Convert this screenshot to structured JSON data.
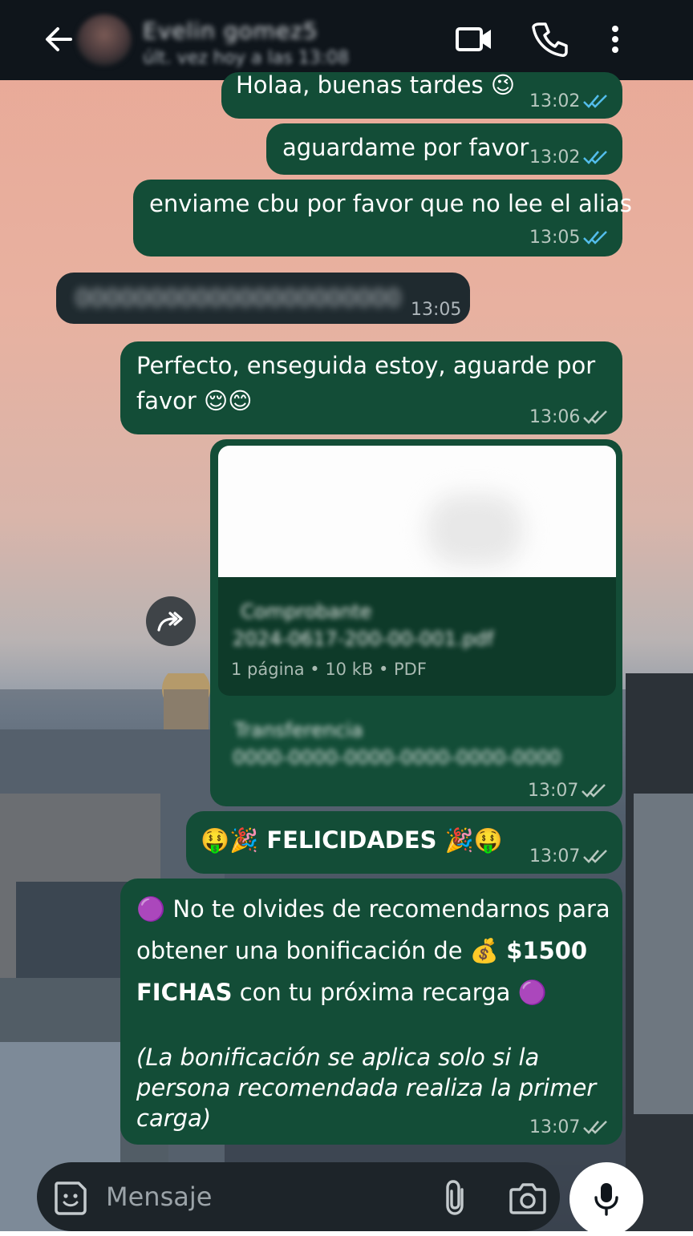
{
  "header": {
    "contact_name": "Evelin gomez5",
    "status": "últ. vez hoy a las 13:08"
  },
  "messages": [
    {
      "text": "Holaa, buenas tardes 😉",
      "time": "13:02"
    },
    {
      "text": "aguardame por favor",
      "time": "13:02"
    },
    {
      "text": "enviame cbu por favor que no lee el alias",
      "time": "13:05"
    },
    {
      "text": "0000000000000000000000",
      "time": "13:05"
    },
    {
      "text_line1": "Perfecto, enseguida estoy, aguarde por",
      "text_line2": "favor 😌😊",
      "time": "13:06"
    },
    {
      "doc_name": "Comprobante",
      "doc_file": "2024-0617-200-00-001.pdf",
      "doc_meta": "1 página • 10 kB • PDF",
      "caption_line1": "Transferencia",
      "caption_line2": "0000-0000-0000-0000-0000-0000",
      "time": "13:07"
    },
    {
      "text": "🤑🎉 FELICIDADES 🎉🤑",
      "time": "13:07"
    },
    {
      "line1": "🟣 No te olvides de recomendarnos para",
      "line2a": "obtener una bonificación de 💰",
      "line2b": "$1500",
      "line3a": "FICHAS",
      "line3b": " con tu próxima recarga 🟣",
      "italic1": "(La bonificación se aplica solo si la",
      "italic2": "persona recomendada realiza la primer",
      "italic3": "carga)",
      "time": "13:07"
    }
  ],
  "composer": {
    "placeholder": "Mensaje"
  },
  "icons": [
    "back-arrow-icon",
    "video-call-icon",
    "phone-icon",
    "more-vert-icon",
    "forward-icon",
    "sticker-icon",
    "attach-icon",
    "camera-icon",
    "mic-icon"
  ],
  "colors": {
    "outgoing_bubble": "#134d37",
    "incoming_bubble": "#1f2a2f",
    "ticks_read": "#53bdeb",
    "appbar": "#0f151b"
  }
}
